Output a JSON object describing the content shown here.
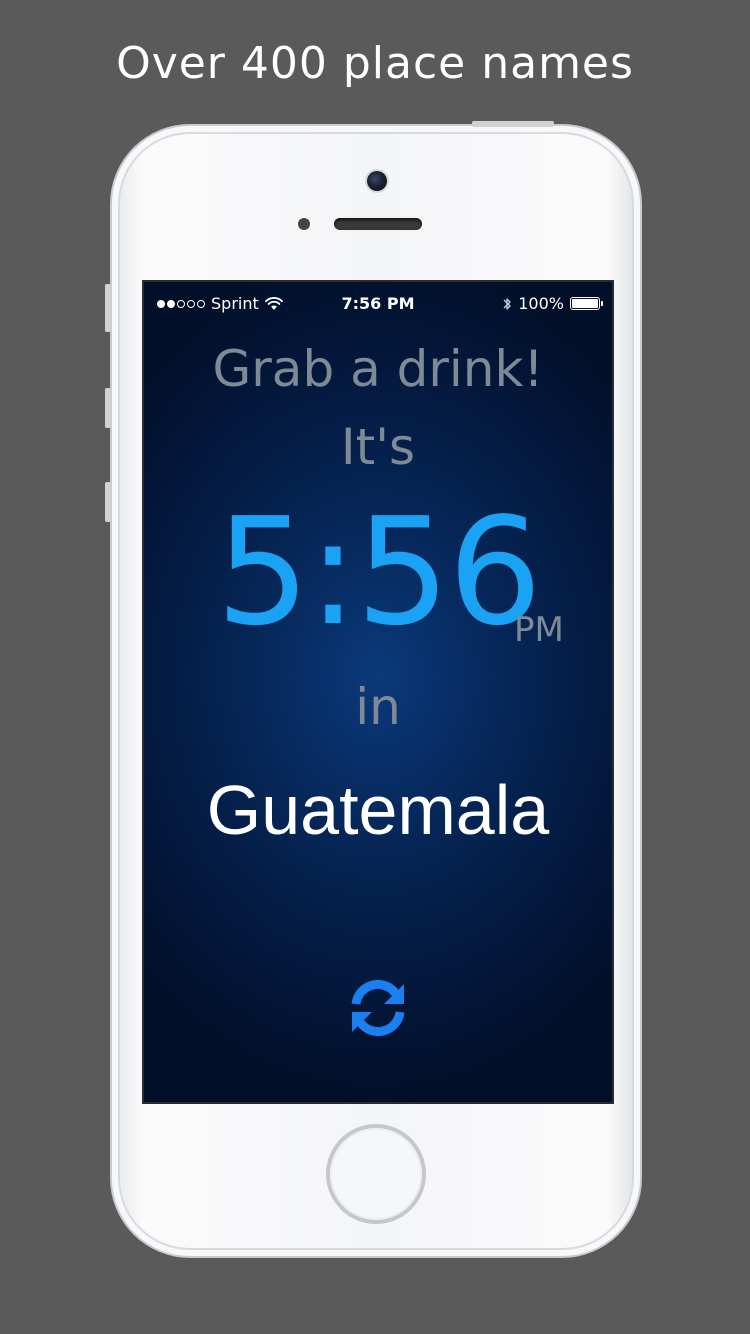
{
  "headline": "Over 400 place names",
  "status_bar": {
    "carrier": "Sprint",
    "time": "7:56 PM",
    "battery": "100%",
    "battery_level": 1.0,
    "signal_bars_filled": 2,
    "signal_bars_total": 5,
    "icons": [
      "signal-dots-icon",
      "wifi-icon",
      "bluetooth-icon",
      "battery-icon"
    ]
  },
  "screen": {
    "line1": "Grab a drink!",
    "line2": "It's",
    "time": "5:56",
    "ampm": "PM",
    "line3": "in",
    "place": "Guatemala",
    "refresh_icon": "refresh-icon"
  },
  "colors": {
    "background": "#5a5a5a",
    "time_blue": "#1aa2f4",
    "muted_text": "#7f8a97",
    "refresh_blue": "#1a7ff0",
    "screen_center": "#0a3a7a",
    "screen_edge": "#020f28"
  }
}
